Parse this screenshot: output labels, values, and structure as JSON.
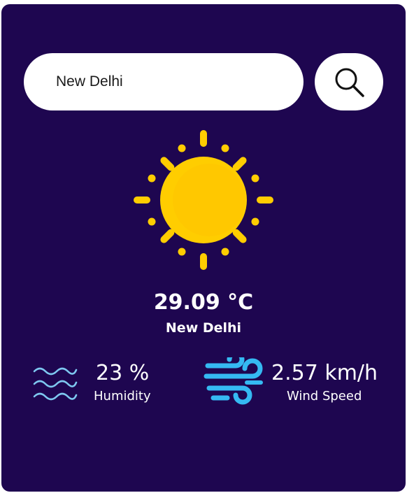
{
  "colors": {
    "card_background": "#1e0650",
    "sun": "#ffcd00",
    "humidity_icon": "#7ec8f0",
    "wind_icon": "#35b9f2"
  },
  "search": {
    "value": "New Delhi",
    "icon": "search-icon"
  },
  "weather": {
    "icon": "sun-icon",
    "temperature": "29.09 °C",
    "city": "New Delhi"
  },
  "humidity": {
    "icon": "humidity-waves-icon",
    "value": "23 %",
    "label": "Humidity"
  },
  "wind": {
    "icon": "wind-icon",
    "value": "2.57 km/h",
    "label": "Wind Speed"
  }
}
